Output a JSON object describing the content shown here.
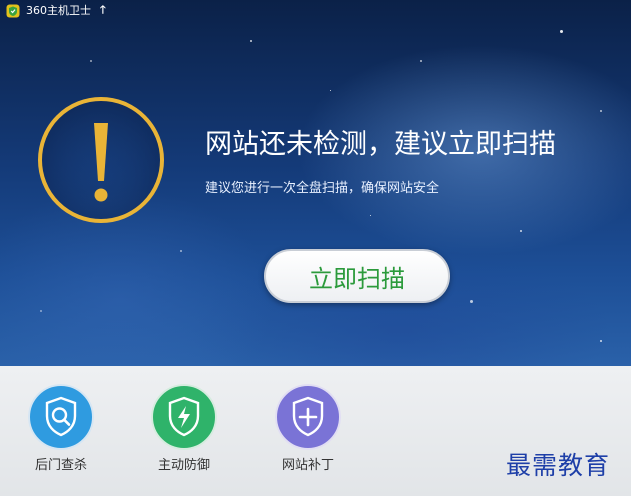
{
  "window": {
    "title": "360主机卫士",
    "upgrade_icon": "up-arrow-icon",
    "upgrade_glyph": "🡑"
  },
  "status": {
    "icon": "exclamation-warning-icon",
    "headline": "网站还未检测，建议立即扫描",
    "subline": "建议您进行一次全盘扫描，确保网站安全"
  },
  "actions": {
    "scan_label": "立即扫描"
  },
  "tools": [
    {
      "label": "后门查杀",
      "icon": "magnifier-shield-icon",
      "color": "#2f9be0"
    },
    {
      "label": "主动防御",
      "icon": "lightning-shield-icon",
      "color": "#2fb36a"
    },
    {
      "label": "网站补丁",
      "icon": "plus-shield-icon",
      "color": "#7a73d6"
    }
  ],
  "watermark": "最需教育",
  "colors": {
    "accent_green": "#2b9a3b",
    "ring_gold": "#e9b437"
  }
}
